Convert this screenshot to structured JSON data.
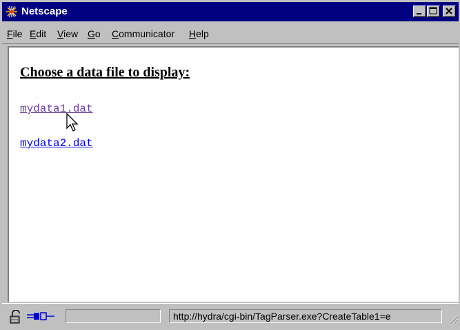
{
  "window": {
    "title": "Netscape",
    "buttons": {
      "minimize": "minimize",
      "maximize": "maximize",
      "close": "close"
    }
  },
  "menubar": {
    "items": [
      {
        "label": "File",
        "mnemonic": "F",
        "rest": "ile"
      },
      {
        "label": "Edit",
        "mnemonic": "E",
        "rest": "dit"
      },
      {
        "label": "View",
        "mnemonic": "V",
        "rest": "iew"
      },
      {
        "label": "Go",
        "mnemonic": "G",
        "rest": "o"
      },
      {
        "label": "Communicator",
        "mnemonic": "C",
        "rest": "ommunicator"
      },
      {
        "label": "Help",
        "mnemonic": "H",
        "rest": "elp"
      }
    ]
  },
  "page": {
    "heading": "Choose a data file to display:",
    "links": [
      {
        "text": "mydata1.dat",
        "visited": true
      },
      {
        "text": "mydata2.dat",
        "visited": false
      }
    ]
  },
  "status": {
    "url": "http://hydra/cgi-bin/TagParser.exe?CreateTable1=e",
    "icons": [
      "security-lock-icon",
      "connection-plug-icon"
    ]
  },
  "colors": {
    "title_bar": "#000080",
    "chrome": "#c0c0c0",
    "visited_link": "#6a3d9a",
    "link": "#0000ee"
  }
}
